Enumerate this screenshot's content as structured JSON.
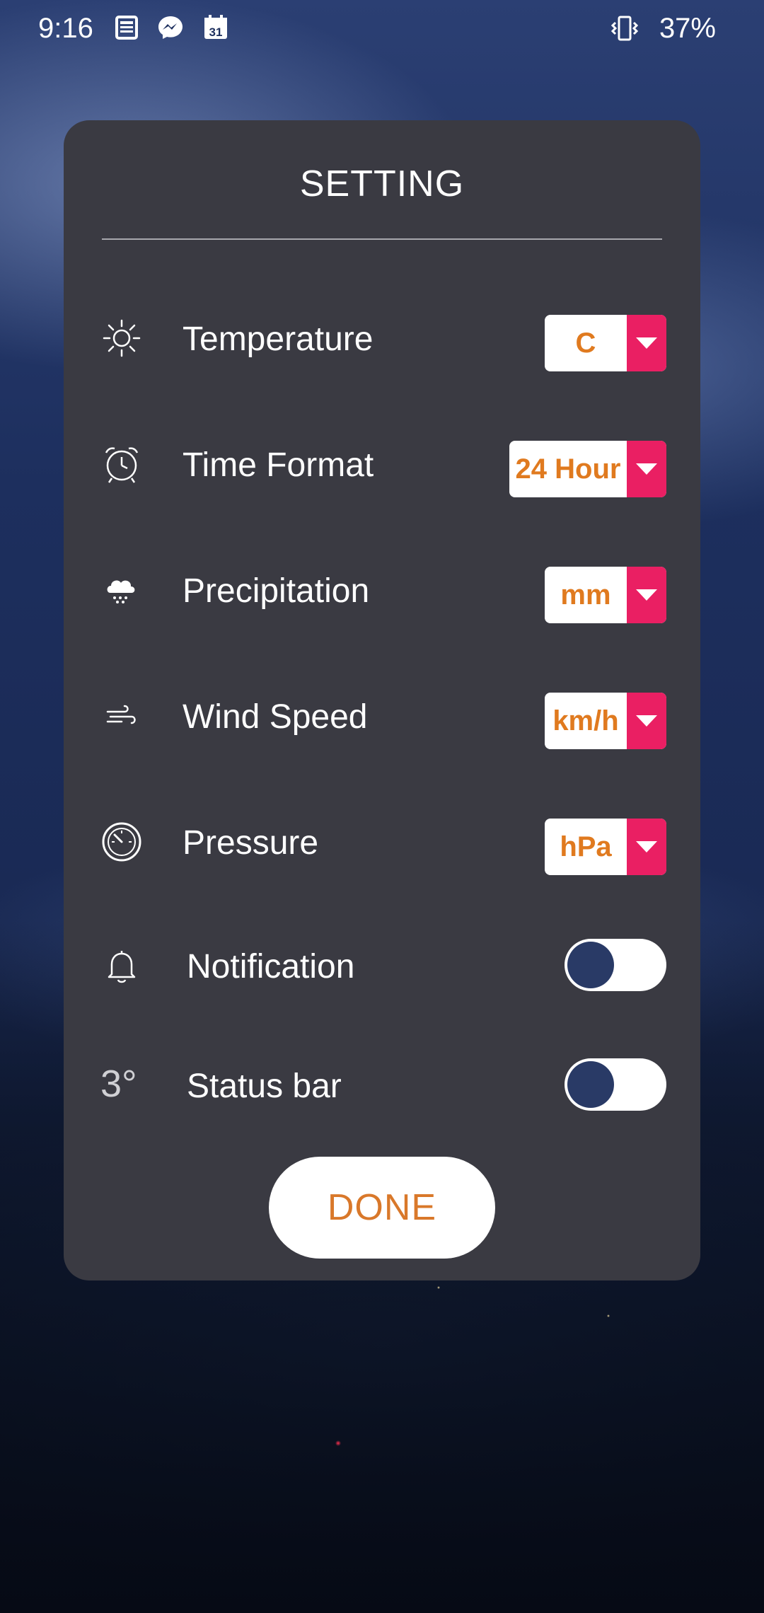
{
  "status_bar": {
    "time": "9:16",
    "battery": "37%",
    "icons": [
      "news-icon",
      "messenger-icon",
      "calendar-icon",
      "vibrate-icon"
    ],
    "calendar_day": "31"
  },
  "dialog": {
    "title": "SETTING",
    "rows": [
      {
        "label": "Temperature",
        "value": "C",
        "icon": "sun-icon"
      },
      {
        "label": "Time Format",
        "value": "24 Hour",
        "icon": "alarm-clock-icon"
      },
      {
        "label": "Precipitation",
        "value": "mm",
        "icon": "rain-cloud-icon"
      },
      {
        "label": "Wind Speed",
        "value": "km/h",
        "icon": "wind-icon"
      },
      {
        "label": "Pressure",
        "value": "hPa",
        "icon": "gauge-icon"
      }
    ],
    "toggles": [
      {
        "label": "Notification",
        "icon": "bell-icon",
        "on": false
      },
      {
        "label": "Status bar",
        "icon": "temperature-degree-icon",
        "icon_text": "3°",
        "on": false
      }
    ],
    "done_label": "DONE"
  },
  "colors": {
    "dialog_bg": "#3a3a42",
    "accent_orange": "#e07a1f",
    "dropdown_arrow": "#ea1f63",
    "toggle_knob": "#293a66"
  }
}
